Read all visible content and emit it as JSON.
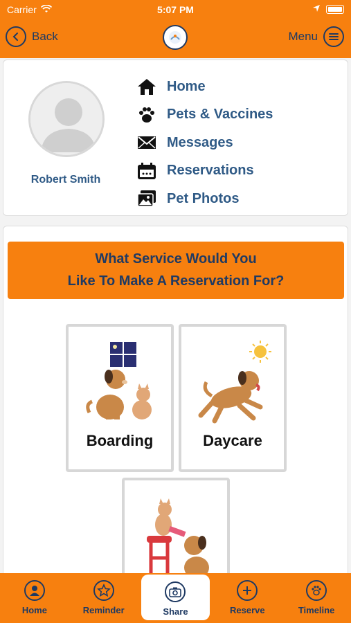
{
  "status": {
    "carrier": "Carrier",
    "time": "5:07 PM"
  },
  "nav": {
    "back_label": "Back",
    "menu_label": "Menu"
  },
  "profile": {
    "name": "Robert Smith"
  },
  "menu_items": [
    {
      "label": "Home",
      "icon": "home-icon"
    },
    {
      "label": "Pets & Vaccines",
      "icon": "paw-icon"
    },
    {
      "label": "Messages",
      "icon": "envelope-icon"
    },
    {
      "label": "Reservations",
      "icon": "calendar-icon"
    },
    {
      "label": "Pet Photos",
      "icon": "photos-icon"
    }
  ],
  "service": {
    "prompt_line1": "What Service Would You",
    "prompt_line2": "Like To Make A Reservation For?",
    "tiles": [
      {
        "label": "Boarding"
      },
      {
        "label": "Daycare"
      },
      {
        "label": ""
      }
    ]
  },
  "tabs": [
    {
      "label": "Home",
      "icon": "user-icon"
    },
    {
      "label": "Reminder",
      "icon": "star-icon"
    },
    {
      "label": "Share",
      "icon": "camera-icon",
      "active": true
    },
    {
      "label": "Reserve",
      "icon": "plus-icon"
    },
    {
      "label": "Timeline",
      "icon": "paw-icon"
    }
  ],
  "colors": {
    "accent": "#f7800f",
    "navy": "#1f3a63",
    "link": "#2f5a86"
  }
}
